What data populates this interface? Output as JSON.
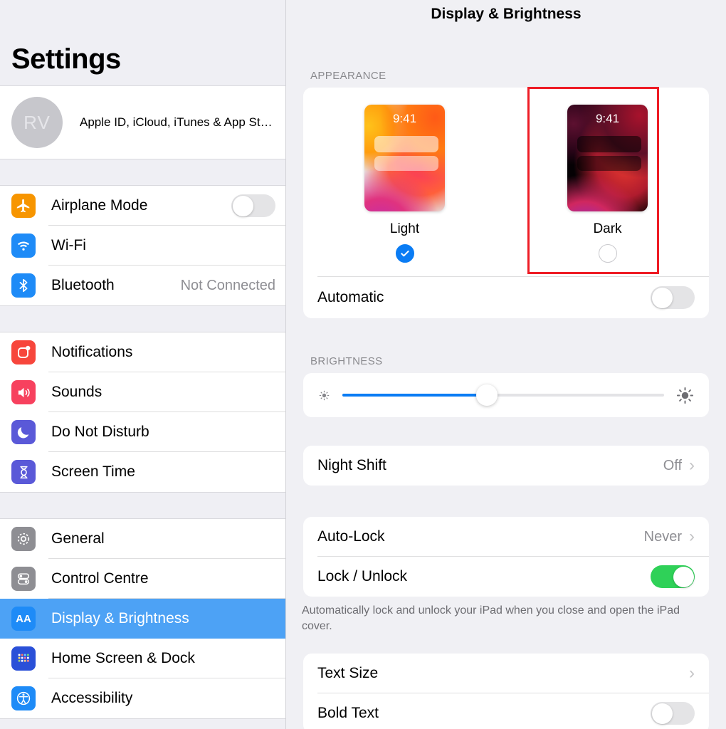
{
  "sidebar": {
    "title": "Settings",
    "profile": {
      "initials": "RV",
      "text": "Apple ID, iCloud, iTunes & App St…"
    },
    "groups": [
      {
        "items": [
          {
            "label": "Airplane Mode",
            "icon": "airplane-icon",
            "color": "#f79500",
            "control": "toggle",
            "on": false
          },
          {
            "label": "Wi-Fi",
            "icon": "wifi-icon",
            "color": "#1e8bf7",
            "control": "none"
          },
          {
            "label": "Bluetooth",
            "icon": "bluetooth-icon",
            "color": "#1e8bf7",
            "control": "value",
            "value": "Not Connected"
          }
        ]
      },
      {
        "items": [
          {
            "label": "Notifications",
            "icon": "notifications-icon",
            "color": "#f7463c",
            "control": "none"
          },
          {
            "label": "Sounds",
            "icon": "sounds-icon",
            "color": "#f7415e",
            "control": "none"
          },
          {
            "label": "Do Not Disturb",
            "icon": "moon-icon",
            "color": "#5a59d8",
            "control": "none"
          },
          {
            "label": "Screen Time",
            "icon": "hourglass-icon",
            "color": "#5a59d8",
            "control": "none"
          }
        ]
      },
      {
        "items": [
          {
            "label": "General",
            "icon": "gear-icon",
            "color": "#8e8e93",
            "control": "none"
          },
          {
            "label": "Control Centre",
            "icon": "sliders-icon",
            "color": "#8e8e93",
            "control": "none"
          },
          {
            "label": "Display & Brightness",
            "icon": "aa-icon",
            "color": "#1e8bf7",
            "control": "none",
            "selected": true
          },
          {
            "label": "Home Screen & Dock",
            "icon": "home-grid-icon",
            "color": "#2a50d8",
            "control": "none"
          },
          {
            "label": "Accessibility",
            "icon": "accessibility-icon",
            "color": "#1e8bf7",
            "control": "none"
          }
        ]
      }
    ]
  },
  "main": {
    "header": "Display & Brightness",
    "appearance": {
      "section_label": "APPEARANCE",
      "modes": [
        {
          "name": "Light",
          "clock": "9:41",
          "selected": true
        },
        {
          "name": "Dark",
          "clock": "9:41",
          "selected": false
        }
      ],
      "automatic": {
        "label": "Automatic",
        "on": false
      }
    },
    "brightness": {
      "section_label": "BRIGHTNESS",
      "value_percent": 45,
      "low_icon": "brightness-low-icon",
      "high_icon": "brightness-high-icon"
    },
    "night_shift": {
      "label": "Night Shift",
      "value": "Off"
    },
    "lock": {
      "auto_lock": {
        "label": "Auto-Lock",
        "value": "Never"
      },
      "lock_unlock": {
        "label": "Lock / Unlock",
        "on": true
      },
      "footnote": "Automatically lock and unlock your iPad when you close and open the iPad cover."
    },
    "text": {
      "text_size": {
        "label": "Text Size"
      },
      "bold_text": {
        "label": "Bold Text",
        "on": false
      }
    }
  },
  "annotation": {
    "color": "#ee1c25",
    "target": "dark-mode-option"
  }
}
